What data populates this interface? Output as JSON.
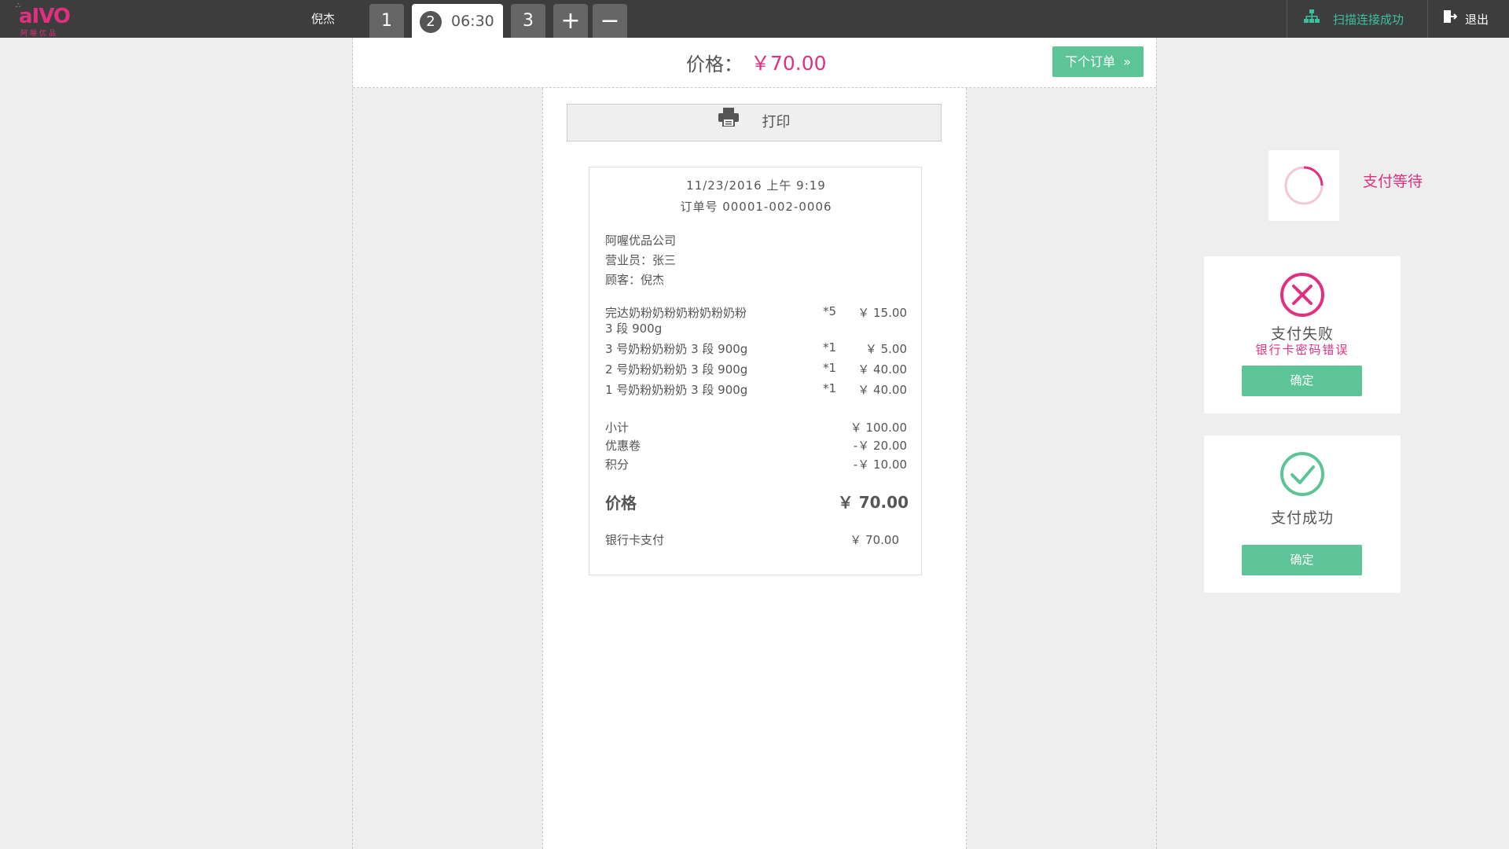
{
  "app": {
    "logo_text": "aIVO",
    "logo_sub": "阿喔优品",
    "user_name": "倪杰"
  },
  "tabs": {
    "t1": "1",
    "t2_num": "2",
    "t2_time": "06:30",
    "t3": "3",
    "add": "+",
    "remove": "−"
  },
  "header": {
    "scan_status": "扫描连接成功",
    "logout": "退出"
  },
  "price_bar": {
    "label": "价格：",
    "value": "￥70.00",
    "next_order": "下个订单"
  },
  "print_label": "打印",
  "receipt": {
    "datetime": "11/23/2016 上午 9:19",
    "order_no": "订单号 00001-002-0006",
    "company": "阿喔优品公司",
    "salesperson": "营业员：张三",
    "customer": "顾客：倪杰",
    "items": [
      {
        "name1": "完达奶粉奶粉奶粉奶粉奶粉",
        "name2": "3 段 900g",
        "qty": "*5",
        "price": "￥ 15.00"
      },
      {
        "name1": "3 号奶粉奶粉奶 3 段 900g",
        "name2": "",
        "qty": "*1",
        "price": "￥ 5.00"
      },
      {
        "name1": "2 号奶粉奶粉奶 3 段 900g",
        "name2": "",
        "qty": "*1",
        "price": "￥ 40.00"
      },
      {
        "name1": "1 号奶粉奶粉奶 3 段 900g",
        "name2": "",
        "qty": "*1",
        "price": "￥ 40.00"
      }
    ],
    "subtotal_label": "小计",
    "subtotal": "￥ 100.00",
    "coupon_label": "优惠卷",
    "coupon": "-￥ 20.00",
    "points_label": "积分",
    "points": "-￥ 10.00",
    "total_label": "价格",
    "total": "￥ 70.00",
    "pay_method": "银行卡支付",
    "pay_amount": "￥ 70.00"
  },
  "status": {
    "waiting": "支付等待",
    "fail_title": "支付失败",
    "fail_reason": "银行卡密码错误",
    "fail_confirm": "确定",
    "ok_title": "支付成功",
    "ok_confirm": "确定"
  },
  "colors": {
    "accent_pink": "#e0307f",
    "accent_green": "#5cc496",
    "topbar": "#3d3d3d"
  }
}
